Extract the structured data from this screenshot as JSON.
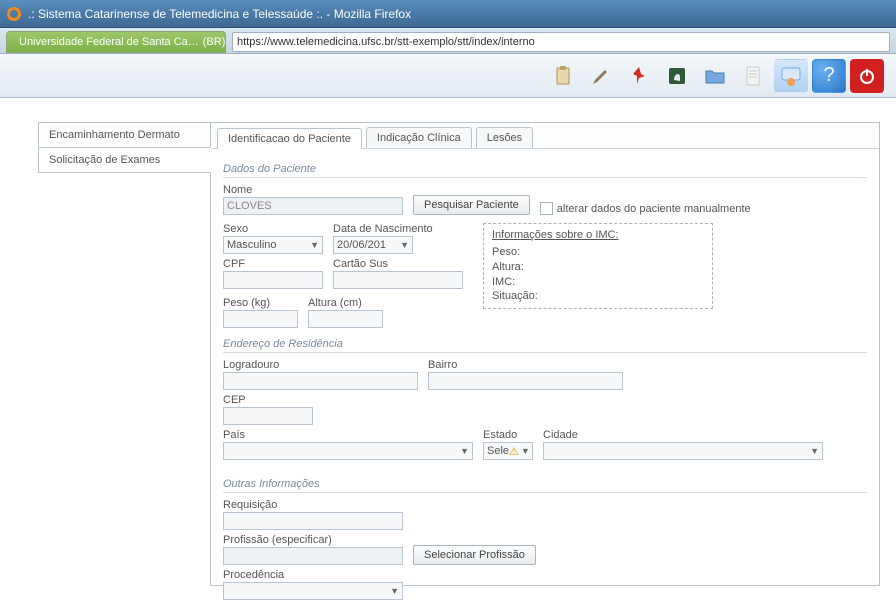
{
  "window": {
    "title": ".: Sistema Catarinense de Telemedicina e Telessaúde :. - Mozilla Firefox"
  },
  "browser": {
    "tab_label": "Universidade Federal de Santa Ca…",
    "tab_suffix": "(BR)",
    "url": "https://www.telemedicina.ufsc.br/stt-exemplo/stt/index/interno"
  },
  "leftnav": {
    "items": [
      {
        "label": "Encaminhamento Dermato"
      },
      {
        "label": "Solicitação de Exames"
      }
    ]
  },
  "subtabs": {
    "items": [
      {
        "label": "Identificacao do Paciente"
      },
      {
        "label": "Indicação Clínica"
      },
      {
        "label": "Lesões"
      }
    ]
  },
  "sections": {
    "dados": {
      "title": "Dados do Paciente",
      "nome_label": "Nome",
      "nome_value": "CLOVES",
      "pesquisar_btn": "Pesquisar Paciente",
      "alterar_label": "alterar dados do paciente manualmente",
      "sexo_label": "Sexo",
      "sexo_value": "Masculino",
      "data_label": "Data de Nascimento",
      "data_value": "20/06/201",
      "cpf_label": "CPF",
      "cartao_label": "Cartão Sus",
      "peso_label": "Peso (kg)",
      "altura_label": "Altura (cm)",
      "imc": {
        "title": "Informações sobre o IMC:",
        "peso": "Peso:",
        "altura": "Altura:",
        "imc": "IMC:",
        "situacao": "Situação:"
      }
    },
    "endereco": {
      "title": "Endereço de Residência",
      "logradouro_label": "Logradouro",
      "bairro_label": "Bairro",
      "cep_label": "CEP",
      "pais_label": "País",
      "estado_label": "Estado",
      "estado_value": "Sele",
      "cidade_label": "Cidade"
    },
    "outras": {
      "title": "Outras Informações",
      "requisicao_label": "Requisição",
      "profissao_label": "Profissão (especificar)",
      "selecionar_btn": "Selecionar Profissão",
      "procedencia_label": "Procedência"
    }
  }
}
